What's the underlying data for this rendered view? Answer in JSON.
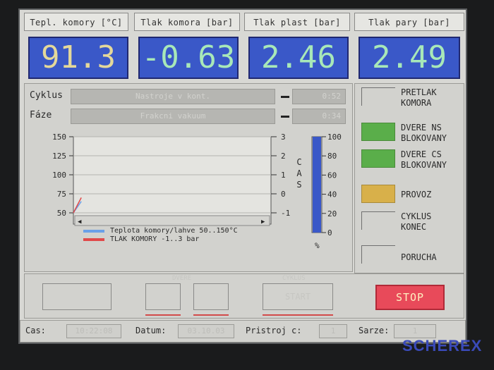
{
  "header": {
    "temp_label": "Tepl. komory [°C]",
    "chamber_pressure_label": "Tlak  komora [bar]",
    "plastic_pressure_label": "Tlak plast [bar]",
    "steam_pressure_label": "Tlak pary [bar]"
  },
  "readings": {
    "temp": "91.3",
    "chamber_pressure": "-0.63",
    "plastic_pressure": "2.46",
    "steam_pressure": "2.49"
  },
  "colors": {
    "value_bg": "#3a58c8",
    "temp_text": "#e4d89a",
    "value_text": "#a8e8b8",
    "stop": "#e84a5a"
  },
  "process": {
    "cycle_label": "Cyklus",
    "cycle_value": "Nastroje v kont.",
    "cycle_time": "0:52",
    "phase_label": "Fáze",
    "phase_value": "Frakcni vakuum",
    "phase_time": "0:34"
  },
  "chart": {
    "left_ticks": [
      "150",
      "125",
      "100",
      "75",
      "50"
    ],
    "right_ticks": [
      "3",
      "2",
      "1",
      "0",
      "-1"
    ],
    "bar_ticks": [
      "100",
      "80",
      "60",
      "40",
      "20",
      "0"
    ],
    "cas_letters": [
      "C",
      "A",
      "S"
    ],
    "percent": "%",
    "legend": [
      {
        "label": "Teplota komory/lahve 50..150°C",
        "color": "#6aa0e8"
      },
      {
        "label": "TLAK KOMORY    -1..3 bar",
        "color": "#e04a4a"
      }
    ],
    "bar_level": 100
  },
  "chart_data": {
    "type": "line",
    "series": [
      {
        "name": "Teplota komory/lahve 50..150°C",
        "x": [
          0,
          0.04
        ],
        "y": [
          50,
          65
        ]
      },
      {
        "name": "TLAK KOMORY    -1..3 bar",
        "x": [
          0,
          0.04
        ],
        "y": [
          -1,
          -0.2
        ]
      }
    ],
    "ylim": [
      50,
      150
    ],
    "y2lim": [
      -1,
      3
    ]
  },
  "status": {
    "overpressure": "PRETLAK\nKOMORA",
    "door_ns": "DVERE NS\nBLOKOVANY",
    "door_cs": "DVERE CS\nBLOKOVANY",
    "operation": "PROVOZ",
    "cycle_end": "CYKLUS\nKONEC",
    "fault": "PORUCHA"
  },
  "controls": {
    "doors_label": "DVERE",
    "cycle_label": "CYKLUS",
    "start_label": "START",
    "stop_label": "STOP"
  },
  "footer": {
    "time_label": "Cas:",
    "time_value": "10:22:08",
    "date_label": "Datum:",
    "date_value": "03.10.03",
    "device_label": "Pristroj c:",
    "device_value": "1",
    "batch_label": "Sarze:",
    "batch_value": "1"
  },
  "brand": "SCHEREX"
}
